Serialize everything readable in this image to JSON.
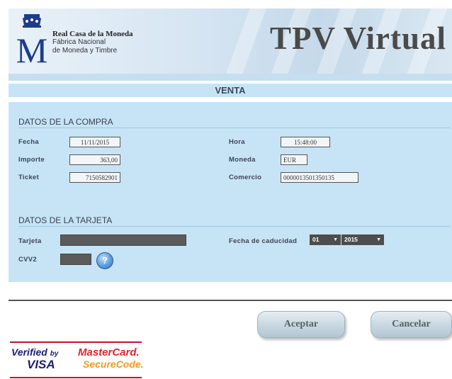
{
  "header": {
    "logo_line1": "Real Casa de la Moneda",
    "logo_line2": "Fábrica Nacional",
    "logo_line3": "de Moneda y Timbre",
    "title": "TPV Virtual"
  },
  "page_title": "VENTA",
  "purchase": {
    "section_title": "DATOS DE LA COMPRA",
    "fecha_label": "Fecha",
    "fecha_value": "11/11/2015",
    "hora_label": "Hora",
    "hora_value": "15:48:00",
    "importe_label": "Importe",
    "importe_value": "363,00",
    "moneda_label": "Moneda",
    "moneda_value": "EUR",
    "ticket_label": "Ticket",
    "ticket_value": "7150582901",
    "comercio_label": "Comercio",
    "comercio_value": "0000013501350135"
  },
  "card": {
    "section_title": "DATOS DE LA TARJETA",
    "tarjeta_label": "Tarjeta",
    "tarjeta_value": "",
    "caducidad_label": "Fecha de caducidad",
    "month_selected": "01",
    "year_selected": "2015",
    "cvv_label": "CVV2",
    "cvv_value": "",
    "help_glyph": "?"
  },
  "buttons": {
    "accept": "Aceptar",
    "cancel": "Cancelar"
  },
  "badges": {
    "verified_by": "Verified",
    "verified_by_small": "by",
    "visa": "VISA",
    "mastercard": "MasterCard.",
    "securecode": "SecureCode."
  },
  "colors": {
    "panel": "#c6e4f6",
    "mastercard_red": "#e3262b",
    "visa_blue": "#1a1f71"
  }
}
